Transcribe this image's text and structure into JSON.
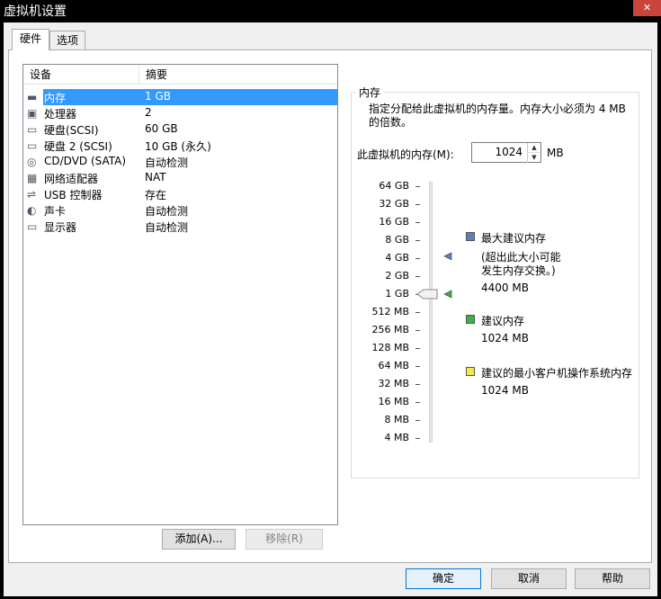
{
  "window": {
    "title": "虚拟机设置",
    "close_icon": "close-icon"
  },
  "tabs": [
    {
      "label": "硬件",
      "active": true
    },
    {
      "label": "选项",
      "active": false
    }
  ],
  "device_list": {
    "headers": {
      "device": "设备",
      "summary": "摘要"
    },
    "rows": [
      {
        "name": "内存",
        "summary": "1 GB",
        "icon": "memory-icon",
        "selected": true
      },
      {
        "name": "处理器",
        "summary": "2",
        "icon": "processor-icon"
      },
      {
        "name": "硬盘(SCSI)",
        "summary": "60 GB",
        "icon": "disk-icon"
      },
      {
        "name": "硬盘 2 (SCSI)",
        "summary": "10 GB (永久)",
        "icon": "disk-icon"
      },
      {
        "name": "CD/DVD (SATA)",
        "summary": "自动检测",
        "icon": "cd-icon"
      },
      {
        "name": "网络适配器",
        "summary": "NAT",
        "icon": "network-icon"
      },
      {
        "name": "USB 控制器",
        "summary": "存在",
        "icon": "usb-icon"
      },
      {
        "name": "声卡",
        "summary": "自动检测",
        "icon": "sound-icon"
      },
      {
        "name": "显示器",
        "summary": "自动检测",
        "icon": "display-icon"
      }
    ]
  },
  "buttons": {
    "add": "添加(A)...",
    "remove": "移除(R)",
    "ok": "确定",
    "cancel": "取消",
    "help": "帮助"
  },
  "memory_panel": {
    "group_title": "内存",
    "description": "指定分配给此虚拟机的内存量。内存大小必须为 4 MB 的倍数。",
    "field_label": "此虚拟机的内存(M):",
    "field_value": "1024",
    "unit": "MB"
  },
  "chart_data": {
    "type": "slider",
    "scale": "log2",
    "tick_labels": [
      "64 GB",
      "32 GB",
      "16 GB",
      "8 GB",
      "4 GB",
      "2 GB",
      "1 GB",
      "512 MB",
      "256 MB",
      "128 MB",
      "64 MB",
      "32 MB",
      "16 MB",
      "8 MB",
      "4 MB"
    ],
    "current_value_mb": 1024,
    "markers": [
      {
        "name": "最大建议内存",
        "value_mb": 4400,
        "color": "#5b7fbf"
      },
      {
        "name": "建议内存",
        "value_mb": 1024,
        "color": "#3cb043"
      },
      {
        "name": "建议的最小客户机操作系统内存",
        "value_mb": 1024,
        "color": "#f5e84a"
      }
    ]
  },
  "legend": [
    {
      "title": "最大建议内存",
      "lines": [
        "(超出此大小可能",
        "发生内存交换。)"
      ],
      "value": "4400 MB",
      "color": "#5b7fbf"
    },
    {
      "title": "建议内存",
      "lines": [],
      "value": "1024 MB",
      "color": "#3cb043"
    },
    {
      "title": "建议的最小客户机操作系统内存",
      "lines": [],
      "value": "1024 MB",
      "color": "#f5e84a"
    }
  ]
}
